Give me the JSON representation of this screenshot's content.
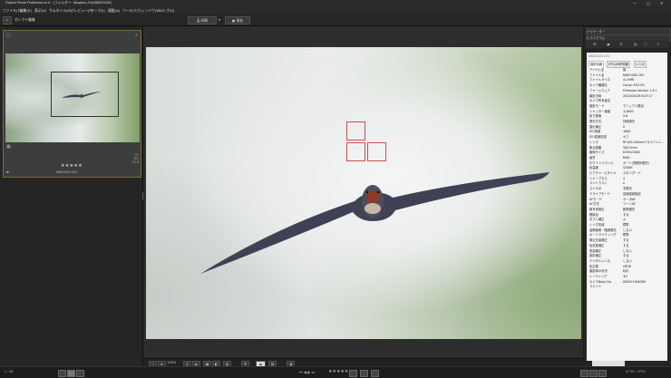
{
  "title": "Digital Photo Professional 4 - [フォルダー: \\Nagano_Fuji\\NBK3428]",
  "window_controls": [
    "—",
    "□",
    "✕"
  ],
  "menu": [
    "ファイル(F)",
    "編集(E)",
    "表示(V)",
    "サムネイル(M)",
    "プレビュー(P)",
    "マーク(L)",
    "調整(A)",
    "ツール(T)",
    "ウィンドウ(W)",
    "ヘルプ(H)"
  ],
  "toolbar": {
    "back_label": "セレクト編集",
    "print_label": "印刷",
    "save_label": "保存"
  },
  "thumbnail": {
    "rating_stars": "★★★★★",
    "filename": "NBK3428.CR3",
    "meta_right": [
      "1/1",
      "ISO",
      "F5.6"
    ]
  },
  "right_panel": {
    "headers": [
      "ナビゲーター",
      "ヒストグラム"
    ],
    "icons": [
      "sliders-icon",
      "palette-icon",
      "crop-icon",
      "layers-icon",
      "info-icon",
      "export-icon"
    ],
    "info_title": "NBK3428.CR3",
    "info_tabs": [
      "撮影情報",
      "IPTC/XMP情報",
      "レンズ"
    ],
    "rows": [
      [
        "アイテム名",
        "撮"
      ],
      [
        "ファイル名",
        "NBK3428.CR3"
      ],
      [
        "ファイルサイズ",
        "41.9MB"
      ],
      [
        "カメラ機種名",
        "Canon EOS R5"
      ],
      [
        "ファームウェア",
        "Firmware Version 1.8.1"
      ],
      [
        "撮影日時",
        "2022/05/28 8:03:17"
      ],
      [
        "カメラ所有者名",
        ""
      ],
      [
        "撮影モード",
        "マニュアル露出"
      ],
      [
        "シャッター速度",
        "1/1600"
      ],
      [
        "絞り数値",
        "5.6"
      ],
      [
        "測光方式",
        "評価測光"
      ],
      [
        "露出補正",
        "0"
      ],
      [
        "ISO感度",
        "1600"
      ],
      [
        "ISO感度拡張",
        "オフ"
      ],
      [
        "レンズ",
        "RF100-500mm F4.5-7.1 L..."
      ],
      [
        "焦点距離",
        "500.0mm"
      ],
      [
        "画像サイズ",
        "8192x5464"
      ],
      [
        "画質",
        "RAW"
      ],
      [
        "ホワイトバランス",
        "オート(雰囲気優先)"
      ],
      [
        "色温度",
        "5200K"
      ],
      [
        "ピクチャースタイル",
        "スタンダード"
      ],
      [
        "シャープネス",
        "4"
      ],
      [
        "コントラスト",
        "0"
      ],
      [
        "ストロボ",
        "非発光"
      ],
      [
        "ドライブモード",
        "高速連続撮影"
      ],
      [
        "AFモード",
        "サーボAF"
      ],
      [
        "AF方式",
        "ゾーンAF"
      ],
      [
        "被写体検出",
        "動物優先"
      ],
      [
        "瞳検出",
        "する"
      ],
      [
        "手ブレ補正",
        "入"
      ],
      [
        "ノイズ低減",
        "標準"
      ],
      [
        "高輝度側・階調優先",
        "しない"
      ],
      [
        "オートライティング",
        "標準"
      ],
      [
        "周辺光量補正",
        "する"
      ],
      [
        "色収差補正",
        "する"
      ],
      [
        "歪曲補正",
        "しない"
      ],
      [
        "回折補正",
        "する"
      ],
      [
        "デジタルレンズ",
        "しない"
      ],
      [
        "色空間",
        "sRGB"
      ],
      [
        "撮影時の状況",
        "晴れ"
      ],
      [
        "レーティング",
        "★5"
      ],
      [
        "カメラBody No.",
        "083021000563"
      ],
      [
        "コメント",
        ""
      ]
    ]
  },
  "bottom_bar": {
    "zoom": "100%",
    "rating_stars": "★★★★★"
  },
  "status": {
    "left": "1 / 48",
    "right": "1 / 1 (100%)",
    "page_info": "4735 / 4735"
  },
  "colors": {
    "af_frame": "#d04a4a",
    "accent_border": "#7a6a3a"
  }
}
